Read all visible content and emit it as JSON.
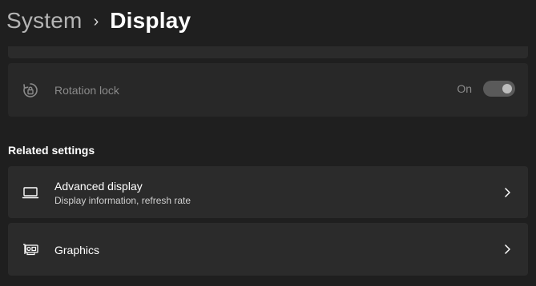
{
  "breadcrumb": {
    "parent": "System",
    "separator": "›",
    "current": "Display"
  },
  "rotation_lock": {
    "label": "Rotation lock",
    "state_text": "On",
    "enabled": false,
    "icon": "rotation-lock-icon"
  },
  "related_settings": {
    "heading": "Related settings",
    "items": [
      {
        "title": "Advanced display",
        "subtitle": "Display information, refresh rate",
        "icon": "monitor-icon"
      },
      {
        "title": "Graphics",
        "icon": "graphics-card-icon"
      }
    ]
  },
  "colors": {
    "background": "#1f1f1f",
    "card": "#2b2b2b",
    "text_primary": "#ffffff",
    "text_disabled": "#8a8a8a"
  }
}
